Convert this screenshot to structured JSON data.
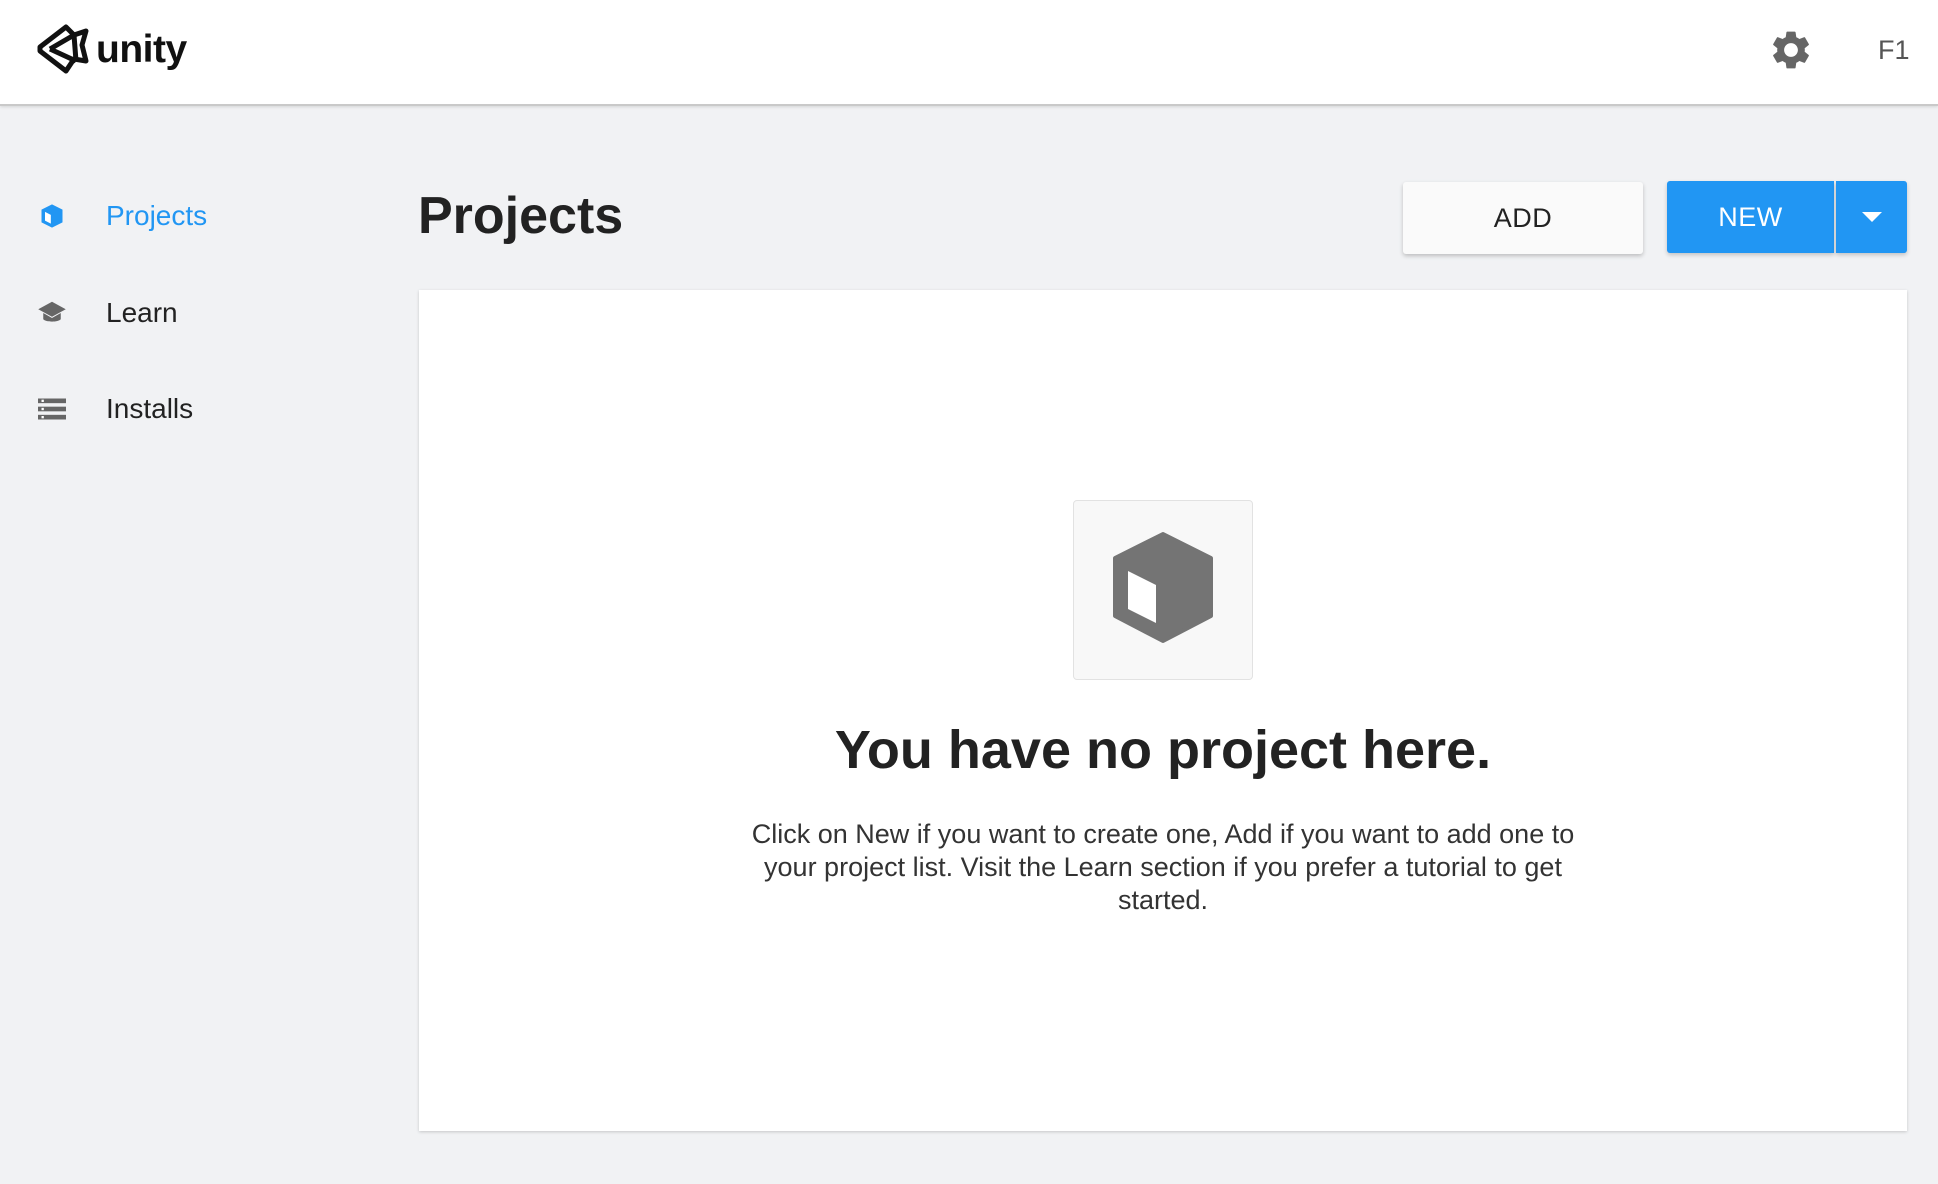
{
  "app": {
    "logo_text": "unity",
    "account_label": "F1",
    "accent_color": "#2196f3"
  },
  "header": {
    "settings_icon": "gear-icon"
  },
  "sidebar": {
    "items": [
      {
        "label": "Projects",
        "icon": "cube-icon",
        "active": true
      },
      {
        "label": "Learn",
        "icon": "graduation-cap-icon",
        "active": false
      },
      {
        "label": "Installs",
        "icon": "list-icon",
        "active": false
      }
    ]
  },
  "main": {
    "title": "Projects",
    "add_label": "ADD",
    "new_label": "NEW",
    "empty": {
      "icon": "cube-icon",
      "title": "You have no project here.",
      "body": "Click on New if you want to create one, Add if you want to add one to your project list. Visit the Learn section if you prefer a tutorial to get started."
    }
  }
}
